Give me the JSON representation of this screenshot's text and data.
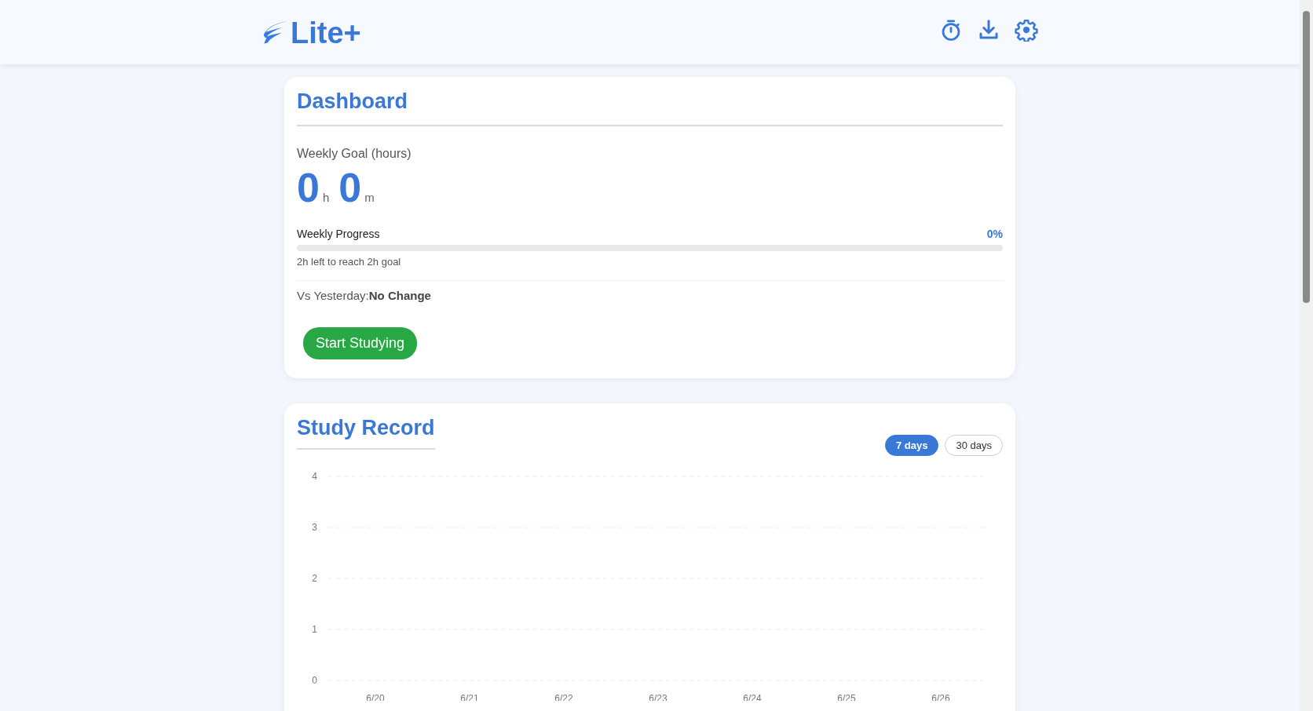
{
  "header": {
    "logo": "Lite+"
  },
  "dashboard": {
    "title": "Dashboard",
    "goal_label": "Weekly Goal (hours)",
    "hours": "0",
    "hours_unit": "h",
    "minutes": "0",
    "minutes_unit": "m",
    "progress_label": "Weekly Progress",
    "progress_percent": "0%",
    "level": 0,
    "remaining": "2h left to reach 2h goal",
    "compare_label": "Vs Yesterday:",
    "compare_value": "No Change",
    "start_button": "Start Studying"
  },
  "study_record": {
    "title": "Study Record",
    "ranges": [
      {
        "label": "7 days",
        "selected": true
      },
      {
        "label": "30 days",
        "selected": false
      }
    ],
    "chart_data": {
      "type": "bar",
      "categories": [
        "6/20",
        "6/21",
        "6/22",
        "6/23",
        "6/24",
        "6/25",
        "6/26"
      ],
      "values": [
        0,
        0,
        0,
        0,
        0,
        0,
        0
      ],
      "grid": true,
      "ylim": [
        0,
        4
      ],
      "yticks": [
        0,
        1,
        2,
        3,
        4
      ]
    }
  }
}
